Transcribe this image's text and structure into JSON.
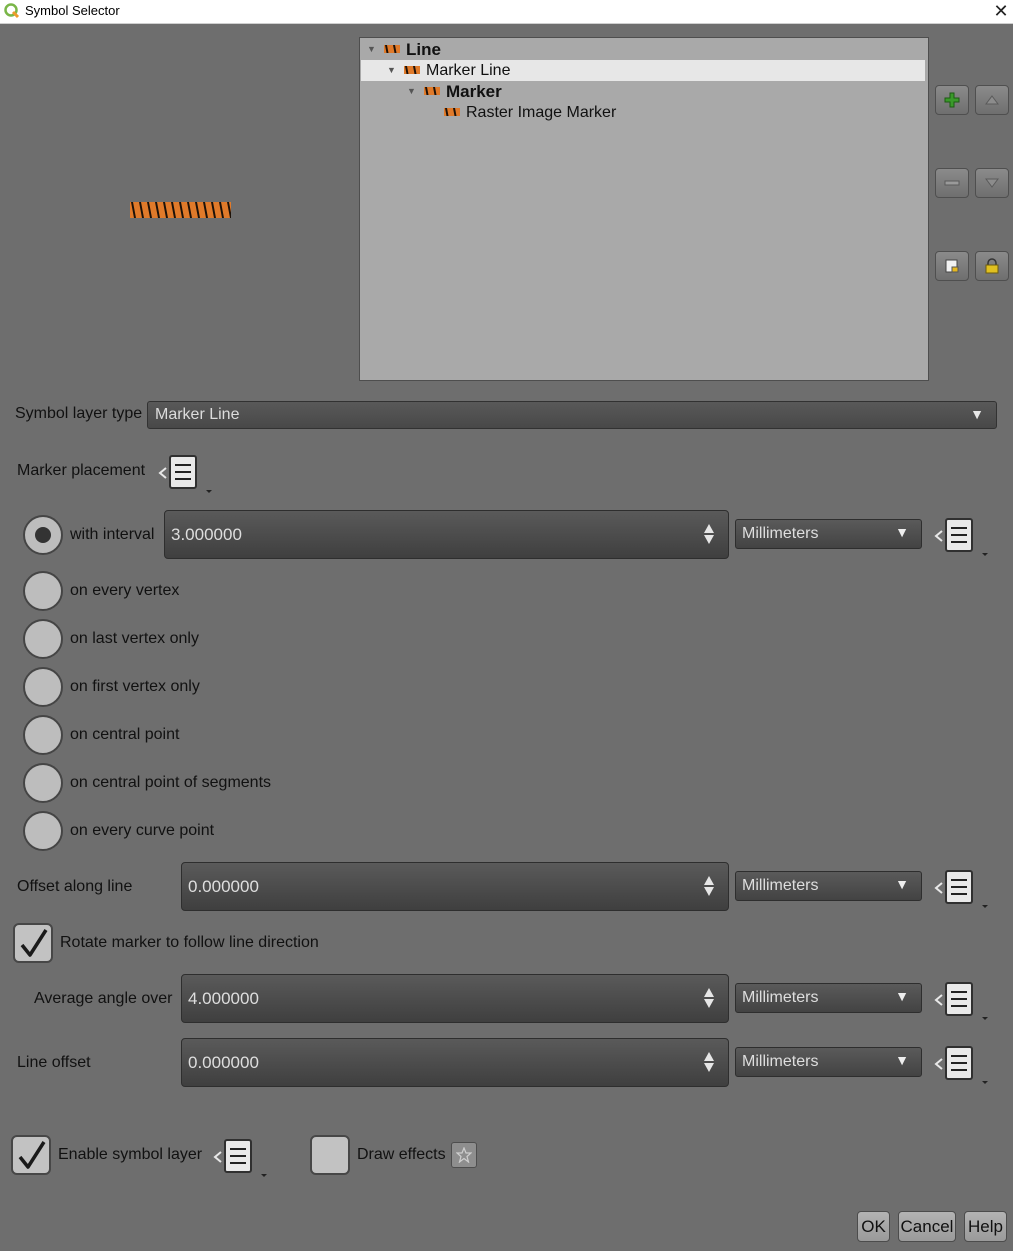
{
  "window": {
    "title": "Symbol Selector",
    "close_glyph": "✕",
    "app_icon": "qgis-icon"
  },
  "tree": {
    "rows": [
      {
        "label": "Line",
        "bold": true
      },
      {
        "label": "Marker Line",
        "bold": false,
        "selected": true
      },
      {
        "label": "Marker",
        "bold": true
      },
      {
        "label": "Raster Image Marker",
        "bold": false
      }
    ]
  },
  "side_buttons": [
    "add-layer-icon",
    "move-up-icon",
    "remove-layer-icon",
    "move-down-icon",
    "duplicate-layer-icon",
    "lock-color-icon"
  ],
  "symbol_layer_type": {
    "label": "Symbol layer type",
    "value": "Marker Line"
  },
  "marker_placement": {
    "label": "Marker placement",
    "interval_value": "3.000000",
    "options": [
      {
        "label": "with interval",
        "checked": true
      },
      {
        "label": "on every vertex",
        "checked": false
      },
      {
        "label": "on last vertex only",
        "checked": false
      },
      {
        "label": "on first vertex only",
        "checked": false
      },
      {
        "label": "on central point",
        "checked": false
      },
      {
        "label": "on central point of segments",
        "checked": false
      },
      {
        "label": "on every curve point",
        "checked": false
      }
    ]
  },
  "offset_along_line": {
    "label": "Offset along line",
    "value": "0.000000"
  },
  "rotate_marker": {
    "label": "Rotate marker to follow line direction",
    "checked": true
  },
  "average_angle": {
    "label": "Average angle over",
    "value": "4.000000"
  },
  "line_offset": {
    "label": "Line offset",
    "value": "0.000000"
  },
  "units": {
    "interval": "Millimeters",
    "offset_along": "Millimeters",
    "average_angle": "Millimeters",
    "line_offset": "Millimeters"
  },
  "enable_layer": {
    "label": "Enable symbol layer",
    "checked": true
  },
  "draw_effects": {
    "label": "Draw effects",
    "checked": false
  },
  "buttons": {
    "ok": "OK",
    "cancel": "Cancel",
    "help": "Help"
  },
  "colors": {
    "background": "#6e6e6e",
    "tree_background": "#a9a9a9",
    "selection": "#e7e7e7",
    "add_icon": "#3a9a2a",
    "lock_icon": "#e0c020",
    "tiger_orange": "#e07a2a"
  }
}
